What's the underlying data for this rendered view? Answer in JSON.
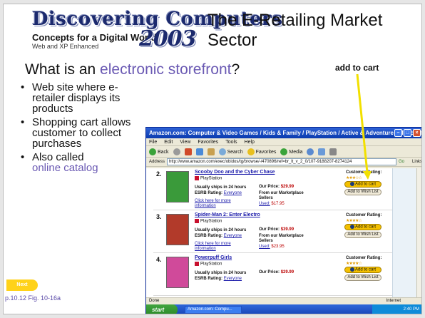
{
  "logo": {
    "word": "Discovering Computers",
    "year": "2003",
    "subtitle": "Concepts for a Digital World",
    "edition": "Web and XP Enhanced"
  },
  "slide": {
    "title": "The E-Retailing Market Sector",
    "question_prefix": "What is an ",
    "question_term": "electronic storefront",
    "question_suffix": "?",
    "add_label": "add to cart",
    "bullets": [
      "Web site where e-retailer displays its products",
      "Shopping cart allows customer to collect purchases",
      "Also called"
    ],
    "bullet3_term": "online catalog",
    "nav_label": "Next",
    "fig_ref": "p.10.12 Fig. 10-16a"
  },
  "browser": {
    "title": "Amazon.com: Computer & Video Games / Kids & Family / PlayStation / Active & Adventure - Microsoft Internet E...",
    "menu": [
      "File",
      "Edit",
      "View",
      "Favorites",
      "Tools",
      "Help"
    ],
    "toolbar": [
      "Back",
      "Search",
      "Favorites",
      "Media"
    ],
    "address_label": "Address",
    "address": "http://www.amazon.com/exec/obidos/tg/browse/-/470896/ref=br_lt_v_2_0/107-9188207-8274124",
    "go": "Go",
    "links": "Links",
    "status_left": "Done",
    "status_zone": "Internet",
    "start": "start",
    "task_item": "Amazon.com: Compu...",
    "tray": "2:40 PM",
    "products": [
      {
        "num": "2.",
        "title": "Scooby Doo and the Cyber Chase",
        "platform": "PlayStation",
        "ship": "Usually ships in 24 hours",
        "esrb_label": "ESRB Rating:",
        "esrb": "Everyone",
        "price_label": "Our Price:",
        "price": "$29.99",
        "market": "From our Marketplace Sellers",
        "used_label": "Used:",
        "used": "$17.95",
        "more": "Click here for more information",
        "rating_label": "Customer Rating:",
        "stars": "★★★☆☆",
        "cart": "Add to cart",
        "wish": "Add to Wish List",
        "cover_color": "#3a9a3a"
      },
      {
        "num": "3.",
        "title": "Spider-Man 2: Enter Electro",
        "platform": "PlayStation",
        "ship": "Usually ships in 24 hours",
        "esrb_label": "ESRB Rating:",
        "esrb": "Everyone",
        "price_label": "Our Price:",
        "price": "$39.99",
        "market": "From our Marketplace Sellers",
        "used_label": "Used:",
        "used": "$23.95",
        "more": "Click here for more information",
        "rating_label": "Customer Rating:",
        "stars": "★★★★☆",
        "cart": "Add to cart",
        "wish": "Add to Wish List",
        "cover_color": "#b23a2a"
      },
      {
        "num": "4.",
        "title": "Powerpuff Girls",
        "platform": "PlayStation",
        "ship": "Usually ships in 24 hours",
        "esrb_label": "ESRB Rating:",
        "esrb": "Everyone",
        "price_label": "Our Price:",
        "price": "$29.99",
        "market": "",
        "used_label": "",
        "used": "",
        "more": "",
        "rating_label": "Customer Rating:",
        "stars": "★★★★☆",
        "cart": "Add to cart",
        "wish": "Add to Wish List",
        "cover_color": "#d04a9a"
      }
    ]
  }
}
